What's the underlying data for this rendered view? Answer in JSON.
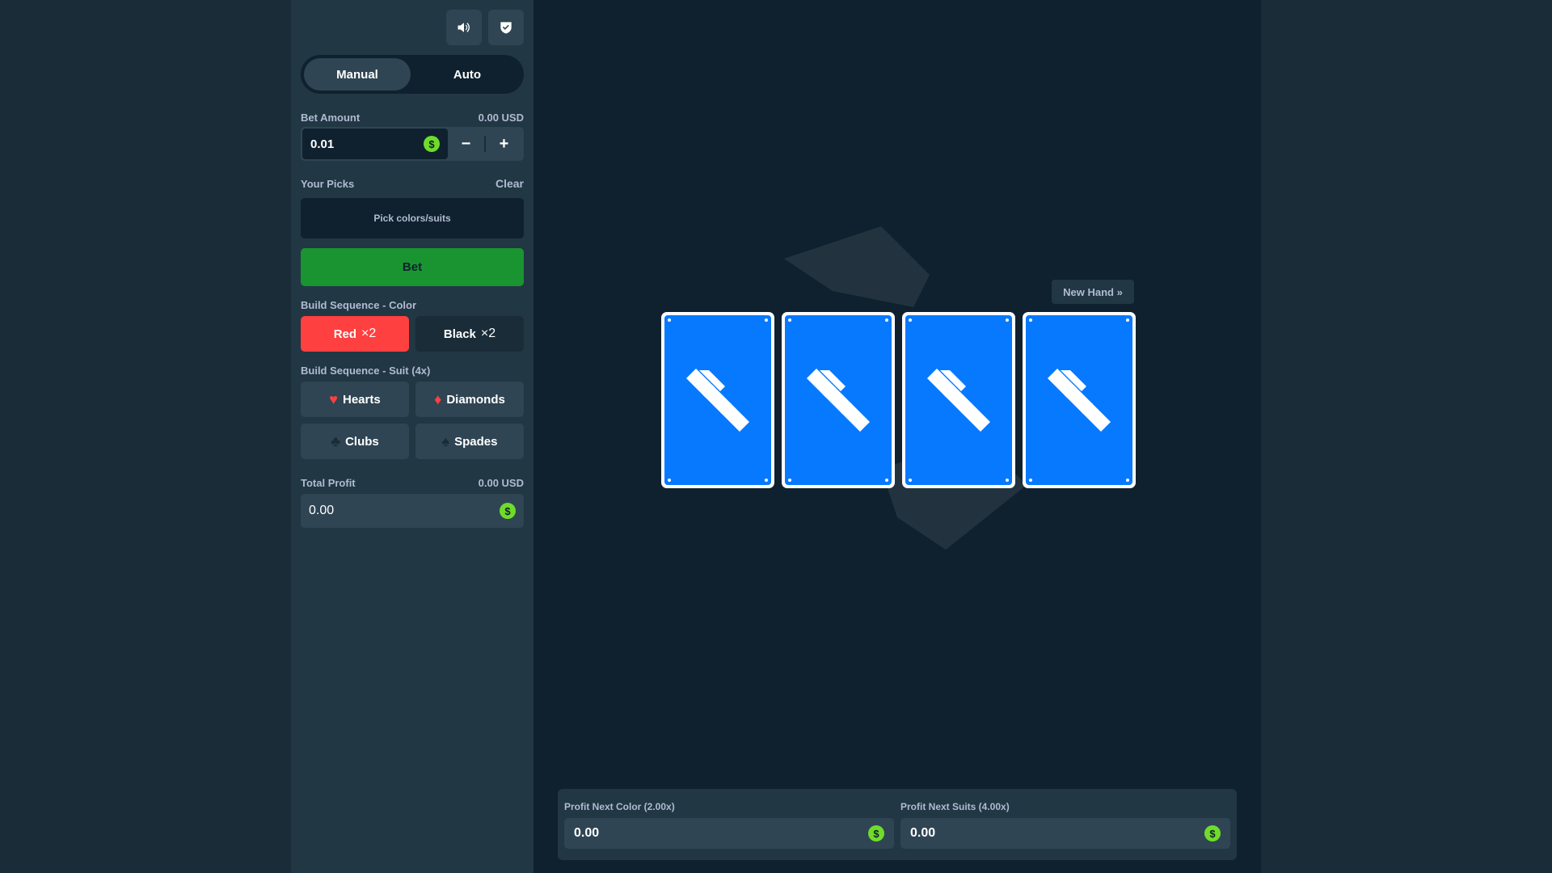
{
  "sidebar": {
    "icons": {
      "sound": "speaker-icon",
      "fairness": "shield-check-icon"
    },
    "tabs": [
      {
        "label": "Manual",
        "active": true
      },
      {
        "label": "Auto",
        "active": false
      }
    ],
    "bet_amount": {
      "label": "Bet Amount",
      "usd": "0.00 USD",
      "value": "0.01",
      "currency_symbol": "$",
      "minus": "−",
      "plus": "+"
    },
    "picks": {
      "label": "Your Picks",
      "clear": "Clear",
      "placeholder": "Pick colors/suits"
    },
    "bet_button": "Bet",
    "color_section": {
      "label": "Build Sequence - Color",
      "red": {
        "label": "Red",
        "mult": "×2"
      },
      "black": {
        "label": "Black",
        "mult": "×2"
      }
    },
    "suit_section": {
      "label": "Build Sequence - Suit (4x)",
      "hearts": {
        "label": "Hearts",
        "glyph": "♥"
      },
      "diamonds": {
        "label": "Diamonds",
        "glyph": "♦"
      },
      "clubs": {
        "label": "Clubs",
        "glyph": "♣"
      },
      "spades": {
        "label": "Spades",
        "glyph": "♠"
      }
    },
    "total_profit": {
      "label": "Total Profit",
      "usd": "0.00 USD",
      "value": "0.00",
      "currency_symbol": "$"
    }
  },
  "game": {
    "new_hand": "New Hand »",
    "cards": [
      {
        "face": "back"
      },
      {
        "face": "back"
      },
      {
        "face": "back"
      },
      {
        "face": "back"
      }
    ],
    "profit_next_color": {
      "label": "Profit Next Color (2.00x)",
      "value": "0.00",
      "currency_symbol": "$"
    },
    "profit_next_suits": {
      "label": "Profit Next Suits (4.00x)",
      "value": "0.00",
      "currency_symbol": "$"
    }
  },
  "colors": {
    "accent_green": "#1a9431",
    "red": "#ff4040",
    "card_blue": "#0779ff",
    "coin": "#6fdc2a"
  }
}
